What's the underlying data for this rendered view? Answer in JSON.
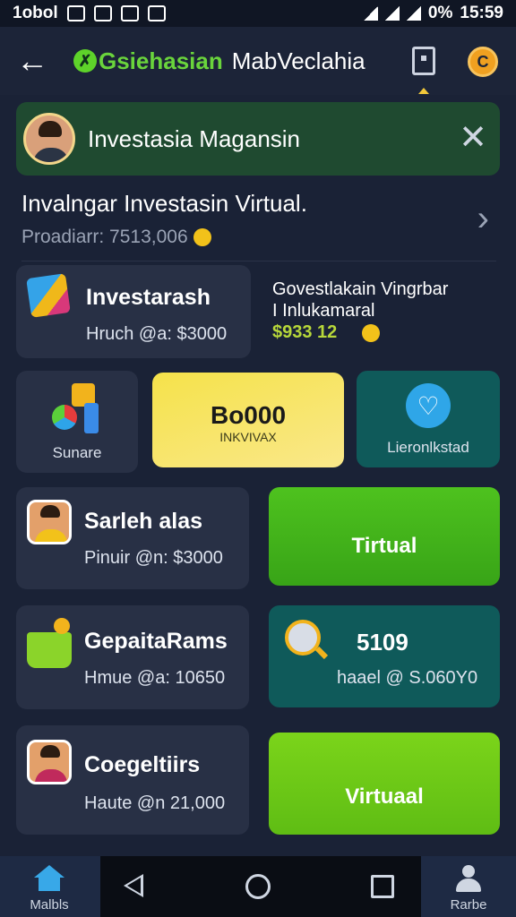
{
  "status_bar": {
    "carrier": "1obol",
    "battery": "0%",
    "time": "15:59"
  },
  "app_bar": {
    "brand_green": "Gsiehasian",
    "brand_white": "MabVeclahia",
    "coin_label": "C"
  },
  "banner": {
    "title": "Investasia Magansin"
  },
  "info": {
    "title": "Invalngar Investasin Virtual.",
    "subtitle": "Proadiarr: 7513,006"
  },
  "cards": {
    "investarash": {
      "title": "Investarash",
      "subtitle": "Hruch @a: $3000"
    },
    "govestlakain": {
      "line1": "Govestlakain Vingrbar",
      "line2": "I Inlukamaral",
      "value": "$933 12"
    },
    "sunare": {
      "label": "Sunare"
    },
    "boooo": {
      "value": "Bo000",
      "sub": "INKVIVAX"
    },
    "lieronikstad": {
      "label": "Lieronlkstad"
    },
    "saneh": {
      "title": "Sarleh alas",
      "subtitle": "Pinuir @n: $3000"
    },
    "tirtual": {
      "label": "Tirtual"
    },
    "gepaita": {
      "title": "GepaitaRams",
      "subtitle": "Hmue @a: 10650"
    },
    "five": {
      "value": "5109",
      "sub": "haael @ S.060Y0"
    },
    "coegel": {
      "title": "Coegeltiirs",
      "subtitle": "Haute @n 21,000"
    },
    "virtual": {
      "label": "Virtuaal"
    }
  },
  "bottom_nav": {
    "left_label": "Malbls",
    "right_label": "Rarbe"
  },
  "colors": {
    "background": "#1a2236",
    "accent_green": "#5ed32a",
    "accent_yellow": "#f5e24a",
    "teal": "#0f5a5a"
  }
}
